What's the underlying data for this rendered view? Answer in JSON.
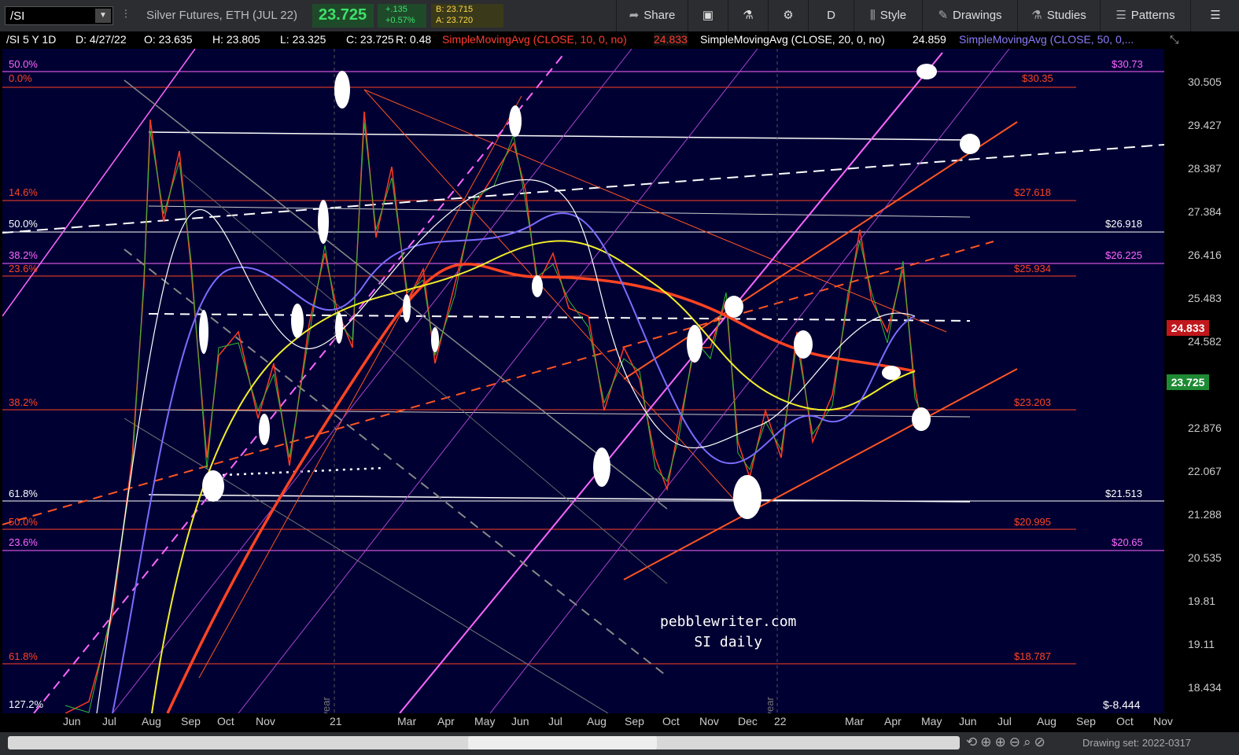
{
  "toolbar": {
    "symbol": "/SI",
    "description": "Silver Futures, ETH (JUL 22)",
    "last": "23.725",
    "change_abs": "+.135",
    "change_pct": "+0.57%",
    "bid": "B: 23.715",
    "ask": "A: 23.720",
    "share": "Share",
    "aggregation": "D",
    "style": "Style",
    "drawings": "Drawings",
    "studies": "Studies",
    "patterns": "Patterns"
  },
  "studybar": {
    "info": "/SI 5 Y 1D",
    "date": "D: 4/27/22",
    "open": "O: 23.635",
    "high": "H: 23.805",
    "low": "L: 23.325",
    "close": "C: 23.725",
    "range": "R: 0.48",
    "sma10": "SimpleMovingAvg (CLOSE, 10, 0, no)",
    "sma10_val": "24.833",
    "sma20": "SimpleMovingAvg (CLOSE, 20, 0, no)",
    "sma20_val": "24.859",
    "sma50": "SimpleMovingAvg (CLOSE, 50, 0,..."
  },
  "price_axis": [
    "30.505",
    "29.427",
    "28.387",
    "27.384",
    "26.416",
    "25.483",
    "24.582",
    "22.876",
    "22.067",
    "21.288",
    "20.535",
    "19.81",
    "19.11",
    "18.434",
    "$-8.444"
  ],
  "price_tags": {
    "sma10": "24.833",
    "last": "23.725"
  },
  "time_axis": [
    "Jun",
    "Jul",
    "Aug",
    "Sep",
    "Oct",
    "Nov",
    "21",
    "Mar",
    "Apr",
    "May",
    "Jun",
    "Jul",
    "Aug",
    "Sep",
    "Oct",
    "Nov",
    "Dec",
    "22",
    "Mar",
    "Apr",
    "May",
    "Jun",
    "Jul",
    "Aug",
    "Sep",
    "Oct",
    "Nov"
  ],
  "year_marks": [
    "2020 year",
    "2021 year"
  ],
  "fib_left": [
    {
      "text": "50.0%",
      "color": "#ff66ff"
    },
    {
      "text": "0.0%",
      "color": "#ff4422"
    },
    {
      "text": "14.6%",
      "color": "#ff4422"
    },
    {
      "text": "50.0%",
      "color": "#ffffff"
    },
    {
      "text": "38.2%",
      "color": "#ff66ff"
    },
    {
      "text": "23.6%",
      "color": "#ff4422"
    },
    {
      "text": "38.2%",
      "color": "#ff4422"
    },
    {
      "text": "61.8%",
      "color": "#ffffff"
    },
    {
      "text": "50.0%",
      "color": "#ff4422"
    },
    {
      "text": "23.6%",
      "color": "#ff66ff"
    },
    {
      "text": "61.8%",
      "color": "#ff4422"
    },
    {
      "text": "127.2%",
      "color": "#ffffff"
    }
  ],
  "fib_right": [
    {
      "text": "$30.73",
      "color": "#ff66ff"
    },
    {
      "text": "$30.35",
      "color": "#ff4422"
    },
    {
      "text": "$27.618",
      "color": "#ff4422"
    },
    {
      "text": "$26.918",
      "color": "#ffffff"
    },
    {
      "text": "$26.225",
      "color": "#ff66ff"
    },
    {
      "text": "$25.934",
      "color": "#ff4422"
    },
    {
      "text": "$23.203",
      "color": "#ff4422"
    },
    {
      "text": "$21.513",
      "color": "#ffffff"
    },
    {
      "text": "$20.995",
      "color": "#ff4422"
    },
    {
      "text": "$20.65",
      "color": "#ff66ff"
    },
    {
      "text": "$18.787",
      "color": "#ff4422"
    }
  ],
  "watermark": {
    "line1": "pebblewriter.com",
    "line2": "SI daily"
  },
  "footer": {
    "drawing_set": "Drawing set: 2022-0317"
  }
}
